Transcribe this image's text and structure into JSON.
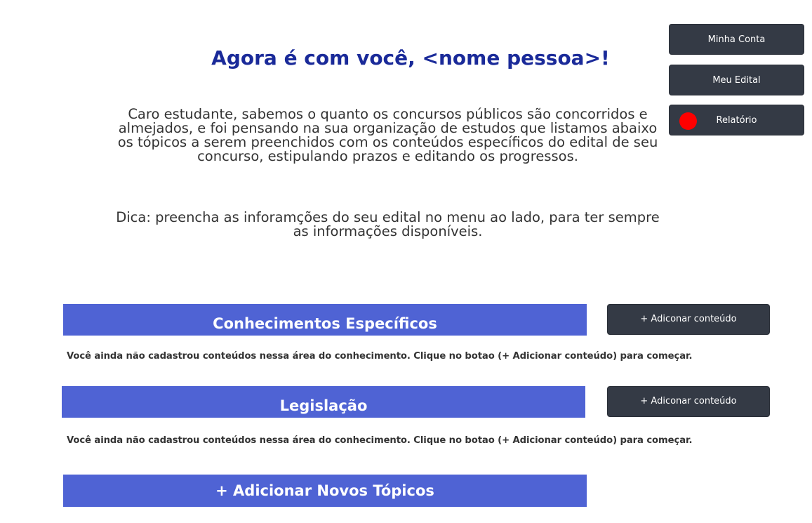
{
  "sidebar": {
    "account_label": "Minha Conta",
    "edital_label": "Meu Edital",
    "report_label": "Relatório"
  },
  "header": {
    "title": "Agora é com você, <nome pessoa>!"
  },
  "intro": {
    "paragraph": "Caro estudante, sabemos o quanto os concursos públicos são concorridos e almejados, e foi pensando na sua organização de estudos que listamos abaixo os tópicos a serem preenchidos com os conteúdos específicos do edital de seu concurso, estipulando prazos e editando os progressos.",
    "tip": "Dica: preencha as inforamções do seu edital no menu ao lado, para ter sempre as informações disponíveis."
  },
  "sections": [
    {
      "title": "Conhecimentos Específicos",
      "add_label": "+ Adiconar conteúdo",
      "empty_message": "Você ainda não cadastrou conteúdos nessa área do conhecimento. Clique no botao (+ Adicionar conteúdo) para começar."
    },
    {
      "title": "Legislação",
      "add_label": "+ Adiconar conteúdo",
      "empty_message": "Você ainda não cadastrou conteúdos nessa área do conhecimento. Clique no botao (+ Adicionar conteúdo) para começar."
    }
  ],
  "add_topics": {
    "label": "+ Adicionar Novos Tópicos"
  },
  "colors": {
    "title": "#1a2a99",
    "section_bar": "#4f63d4",
    "button": "#343a45",
    "report_indicator": "#ff0000"
  }
}
